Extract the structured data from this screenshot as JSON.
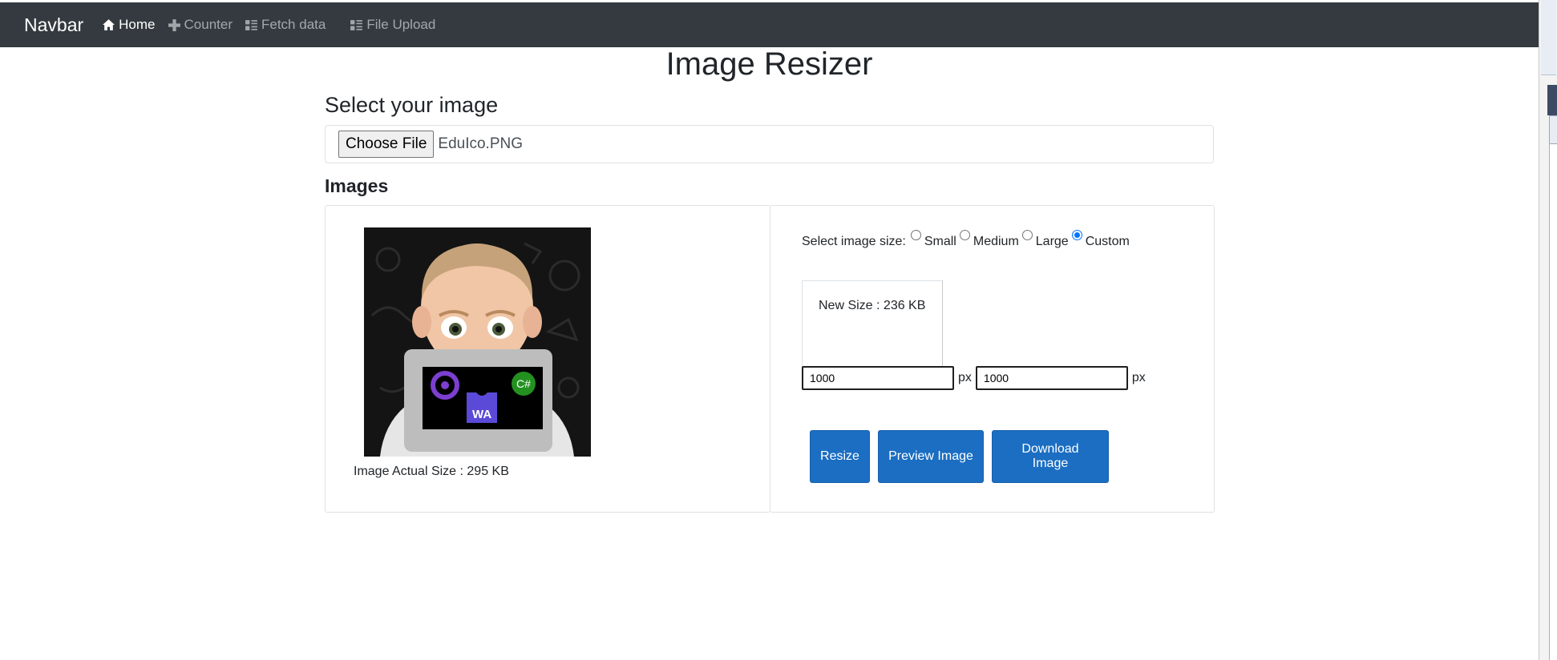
{
  "navbar": {
    "brand": "Navbar",
    "items": [
      {
        "label": "Home",
        "icon": "home-icon",
        "active": true
      },
      {
        "label": "Counter",
        "icon": "plus-icon",
        "active": false
      },
      {
        "label": "Fetch data",
        "icon": "list-icon",
        "active": false
      },
      {
        "label": "File Upload",
        "icon": "list-icon",
        "active": false
      }
    ]
  },
  "page": {
    "title": "Image Resizer",
    "select_label": "Select your image",
    "choose_file_label": "Choose File",
    "file_name": "EduIco.PNG",
    "images_label": "Images"
  },
  "left_panel": {
    "actual_size_text": "Image Actual Size : 295 KB",
    "badge_wa": "WA",
    "badge_cs": "C#"
  },
  "right_panel": {
    "size_label": "Select image size:",
    "size_options": [
      {
        "label": "Small",
        "checked": false
      },
      {
        "label": "Medium",
        "checked": false
      },
      {
        "label": "Large",
        "checked": false
      },
      {
        "label": "Custom",
        "checked": true
      }
    ],
    "new_size_text": "New Size : 236 KB",
    "width_value": "1000",
    "height_value": "1000",
    "unit": "px",
    "buttons": {
      "resize": "Resize",
      "preview": "Preview Image",
      "download": "Download Image"
    }
  },
  "colors": {
    "navbar_bg": "#343a40",
    "primary_button": "#1b6ec2",
    "radio_checked": "#0075ff"
  }
}
